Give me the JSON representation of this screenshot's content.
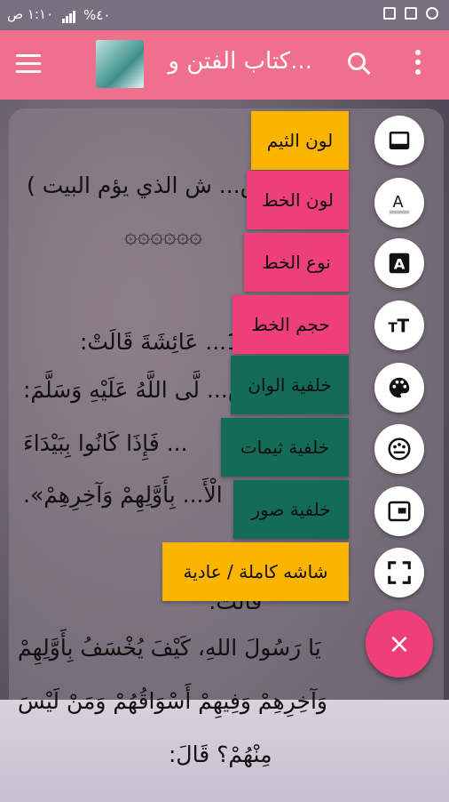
{
  "status_bar": {
    "time": "١:١٠ ص",
    "battery": "%٤٠"
  },
  "app_bar": {
    "title": "كتاب الفتن و..."
  },
  "reader": {
    "line1": "(الخس... ش الذي يؤم البيت )",
    "line2": "۞۞۞۞۞۞",
    "line3": "1... عَائِشَةَ قَالَتْ:",
    "line4": "... رَسُ... لَّى اللَّهُ عَلَيْهِ وَسَلَّمَ:",
    "line5": "... فَإِذَا كَانُوا بِبَيْدَاءَ",
    "line6": "الْأَ... بِأَوَّلِهِمْ وَآخِرِهِمْ».",
    "line7": "قَالَتْ:",
    "line8": "يَا رَسُولَ اللهِ، كَيْفَ يُخْسَفُ بِأَوَّلِهِمْ",
    "line9": "وَآخِرِهِمْ وَفِيهِمْ أَسْوَاقُهُمْ وَمَنْ لَيْسَ",
    "line10": "مِنْهُمْ؟ قَالَ:"
  },
  "menu": [
    {
      "label": "لون الثيم",
      "icon": "theme-icon",
      "color": "#fbb400"
    },
    {
      "label": "لون الخط",
      "icon": "font-color-icon",
      "color": "#ef3f7a"
    },
    {
      "label": "نوع الخط",
      "icon": "font-type-icon",
      "color": "#ef3f7a"
    },
    {
      "label": "حجم الخط",
      "icon": "text-size-icon",
      "color": "#ef3f7a"
    },
    {
      "label": "خلفية الوان",
      "icon": "palette-icon",
      "color": "#136b58"
    },
    {
      "label": "خلفية ثيمات",
      "icon": "themes-icon",
      "color": "#136b58"
    },
    {
      "label": "خلفية صور",
      "icon": "picture-icon",
      "color": "#136b58"
    },
    {
      "label": "شاشه كاملة / عادية",
      "icon": "fullscreen-icon",
      "color": "#fbb400"
    }
  ],
  "close_button": {
    "label": "×"
  }
}
